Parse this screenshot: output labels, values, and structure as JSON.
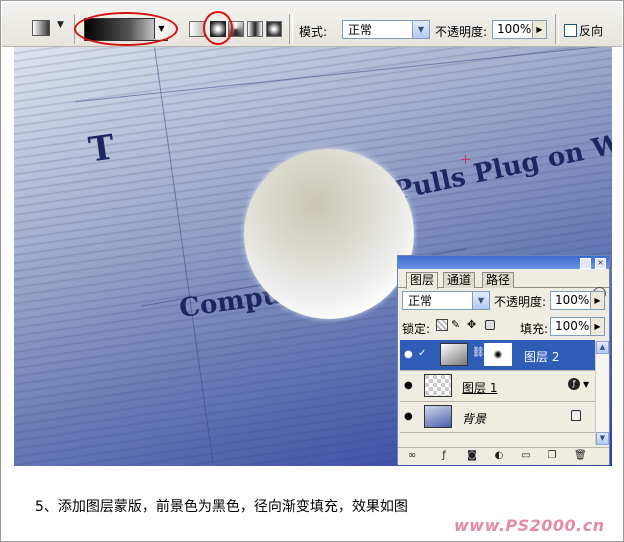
{
  "options_bar": {
    "mode_label": "模式:",
    "mode_value": "正常",
    "opacity_label": "不透明度:",
    "opacity_value": "100%",
    "reverse_label": "反向",
    "gradient_types": [
      "linear-gradient-icon",
      "radial-gradient-icon",
      "angle-gradient-icon",
      "reflected-gradient-icon",
      "diamond-gradient-icon"
    ],
    "highlight_color": "#d41212"
  },
  "photo": {
    "headline_fragments": [
      "Compu",
      "Pulls Plug on W",
      "T"
    ]
  },
  "layers_panel": {
    "tabs": [
      "图层",
      "通道",
      "路径"
    ],
    "blend_mode": "正常",
    "opacity_label": "不透明度:",
    "opacity_value": "100%",
    "lock_label": "锁定:",
    "fill_label": "填充:",
    "fill_value": "100%",
    "layers": [
      {
        "name": "图层 2",
        "selected": true,
        "has_mask": true
      },
      {
        "name": "图层 1",
        "selected": false,
        "has_mask": false
      },
      {
        "name": "背景",
        "selected": false,
        "locked": true
      }
    ],
    "selection_color": "#2f5cb6"
  },
  "caption": "5、添加图层蒙版，前景色为黑色，径向渐变填充，效果如图",
  "watermark": "www.PS2000.cn"
}
